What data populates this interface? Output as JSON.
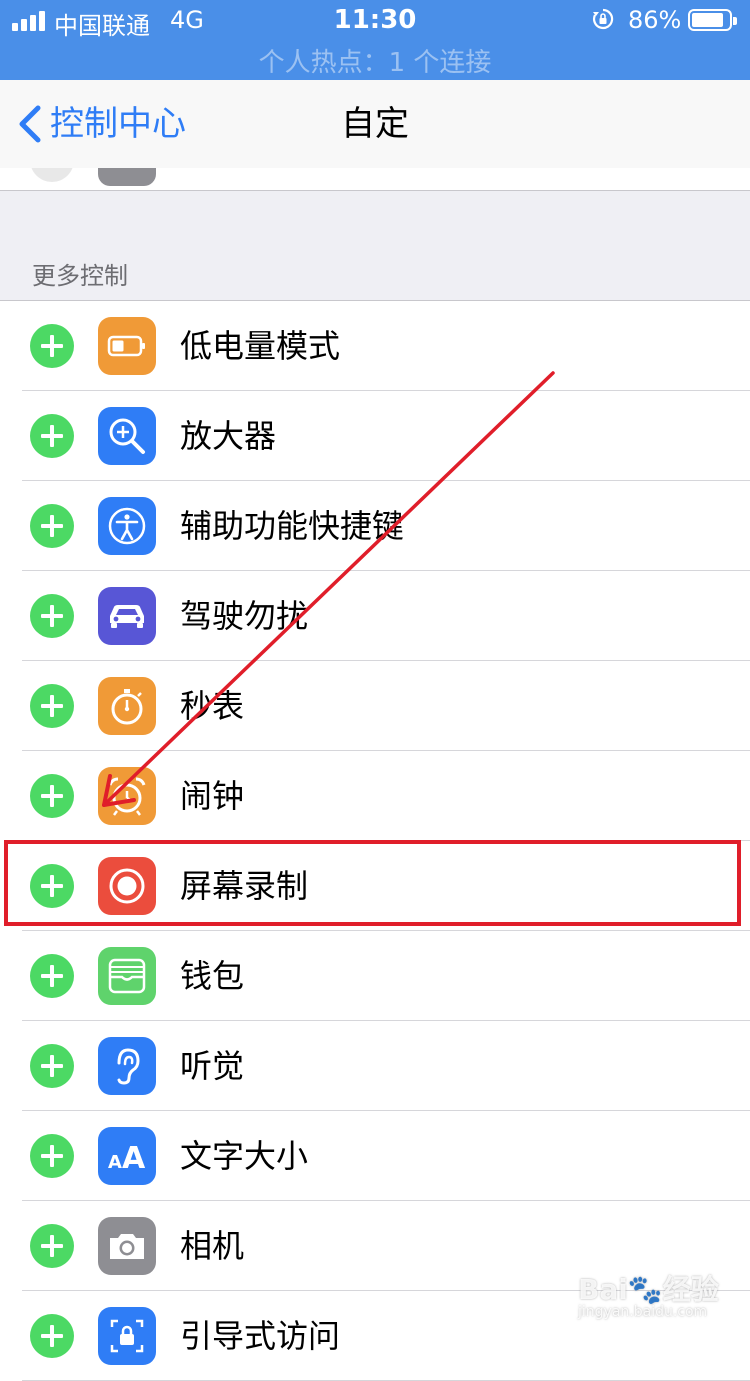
{
  "status_bar": {
    "carrier": "中国联通",
    "network": "4G",
    "time": "11:30",
    "battery_percent": "86%",
    "battery_level": 0.86,
    "hotspot_text": "个人热点：1 个连接",
    "bar_color": "#4a8fe8"
  },
  "nav": {
    "back_label": "控制中心",
    "title": "自定",
    "accent": "#2f7df6"
  },
  "section": {
    "header": "更多控制"
  },
  "items": [
    {
      "label": "低电量模式",
      "icon": "battery-icon",
      "color": "#f09a37"
    },
    {
      "label": "放大器",
      "icon": "magnifier-icon",
      "color": "#2f7df6"
    },
    {
      "label": "辅助功能快捷键",
      "icon": "accessibility-icon",
      "color": "#2f7df6"
    },
    {
      "label": "驾驶勿扰",
      "icon": "car-icon",
      "color": "#5856d6"
    },
    {
      "label": "秒表",
      "icon": "stopwatch-icon",
      "color": "#f09a37"
    },
    {
      "label": "闹钟",
      "icon": "alarm-icon",
      "color": "#f09a37"
    },
    {
      "label": "屏幕录制",
      "icon": "record-icon",
      "color": "#eb4d3d"
    },
    {
      "label": "钱包",
      "icon": "wallet-icon",
      "color": "#5fd36c"
    },
    {
      "label": "听觉",
      "icon": "ear-icon",
      "color": "#2f7df6"
    },
    {
      "label": "文字大小",
      "icon": "text-size-icon",
      "color": "#2f7df6"
    },
    {
      "label": "相机",
      "icon": "camera-icon",
      "color": "#8e8e93"
    },
    {
      "label": "引导式访问",
      "icon": "guided-access-icon",
      "color": "#2f7df6"
    }
  ],
  "annotation": {
    "highlight_color": "#e01e2a",
    "highlighted_item": "屏幕录制"
  },
  "watermark": {
    "brand": "Bai",
    "brand_suffix": "经验",
    "url": "jingyan.baidu.com"
  }
}
